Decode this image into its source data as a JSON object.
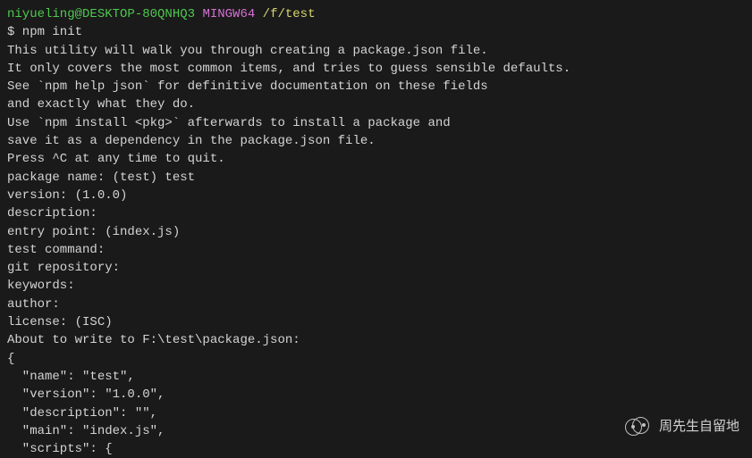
{
  "prompt": {
    "user": "niyueling@DESKTOP-80QNHQ3",
    "shell": "MINGW64",
    "path": "/f/test"
  },
  "command": "$ npm init",
  "output": {
    "l1": "This utility will walk you through creating a package.json file.",
    "l2": "It only covers the most common items, and tries to guess sensible defaults.",
    "l3": "",
    "l4": "See `npm help json` for definitive documentation on these fields",
    "l5": "and exactly what they do.",
    "l6": "",
    "l7": "Use `npm install <pkg>` afterwards to install a package and",
    "l8": "save it as a dependency in the package.json file.",
    "l9": "",
    "l10": "Press ^C at any time to quit.",
    "l11": "package name: (test) test",
    "l12": "version: (1.0.0)",
    "l13": "description:",
    "l14": "entry point: (index.js)",
    "l15": "test command:",
    "l16": "git repository:",
    "l17": "keywords:",
    "l18": "author:",
    "l19": "license: (ISC)",
    "l20": "About to write to F:\\test\\package.json:",
    "l21": "",
    "l22": "{",
    "l23": "  \"name\": \"test\",",
    "l24": "  \"version\": \"1.0.0\",",
    "l25": "  \"description\": \"\",",
    "l26": "  \"main\": \"index.js\",",
    "l27": "  \"scripts\": {"
  },
  "watermark": {
    "text": "周先生自留地"
  }
}
